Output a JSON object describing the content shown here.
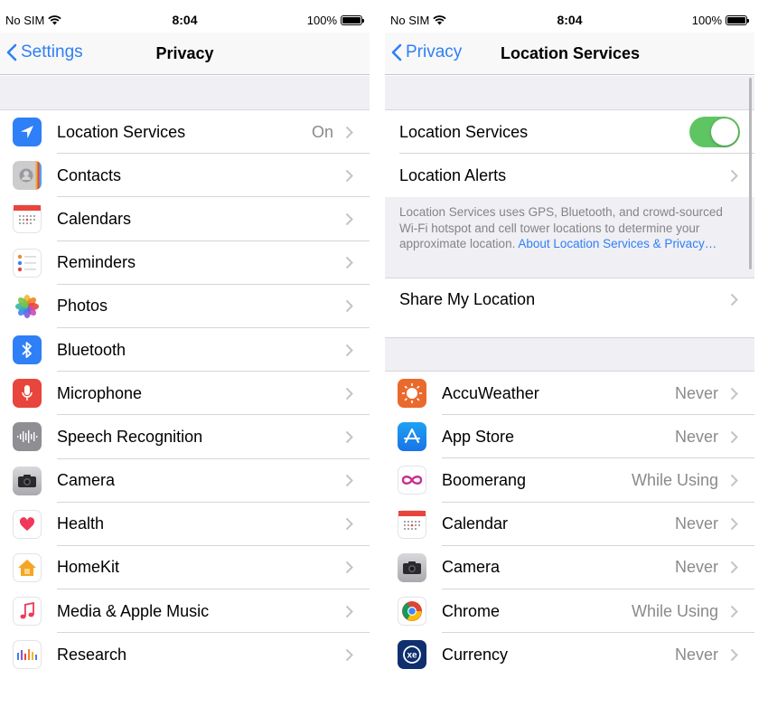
{
  "left": {
    "status": {
      "carrier": "No SIM",
      "time": "8:04",
      "battery": "100%"
    },
    "nav": {
      "back_label": "Settings",
      "title": "Privacy"
    },
    "items": [
      {
        "label": "Location Services",
        "value": "On"
      },
      {
        "label": "Contacts",
        "value": ""
      },
      {
        "label": "Calendars",
        "value": ""
      },
      {
        "label": "Reminders",
        "value": ""
      },
      {
        "label": "Photos",
        "value": ""
      },
      {
        "label": "Bluetooth",
        "value": ""
      },
      {
        "label": "Microphone",
        "value": ""
      },
      {
        "label": "Speech Recognition",
        "value": ""
      },
      {
        "label": "Camera",
        "value": ""
      },
      {
        "label": "Health",
        "value": ""
      },
      {
        "label": "HomeKit",
        "value": ""
      },
      {
        "label": "Media & Apple Music",
        "value": ""
      },
      {
        "label": "Research",
        "value": ""
      }
    ]
  },
  "right": {
    "status": {
      "carrier": "No SIM",
      "time": "8:04",
      "battery": "100%"
    },
    "nav": {
      "back_label": "Privacy",
      "title": "Location Services"
    },
    "location_services_label": "Location Services",
    "location_services_enabled": true,
    "location_alerts_label": "Location Alerts",
    "note_text": "Location Services uses GPS, Bluetooth, and crowd-sourced Wi-Fi hotspot and cell tower locations to determine your approximate location. ",
    "note_link": "About Location Services & Privacy…",
    "share_label": "Share My Location",
    "apps": [
      {
        "label": "AccuWeather",
        "value": "Never"
      },
      {
        "label": "App Store",
        "value": "Never"
      },
      {
        "label": "Boomerang",
        "value": "While Using"
      },
      {
        "label": "Calendar",
        "value": "Never"
      },
      {
        "label": "Camera",
        "value": "Never"
      },
      {
        "label": "Chrome",
        "value": "While Using"
      },
      {
        "label": "Currency",
        "value": "Never"
      }
    ]
  },
  "colors": {
    "accent": "#2f7ff6",
    "toggle_on": "#5fc563",
    "group_bg": "#efeff4"
  }
}
